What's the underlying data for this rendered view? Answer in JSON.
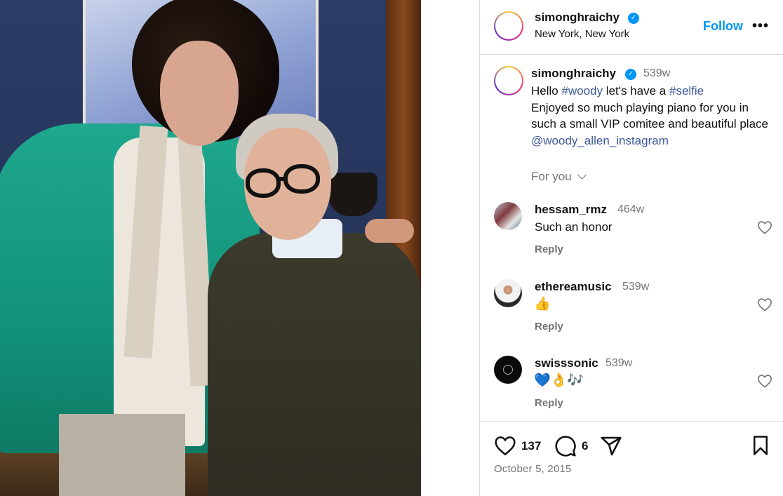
{
  "post": {
    "author": "simonghraichy",
    "location": "New York, New York",
    "follow_label": "Follow",
    "more_label": "•••"
  },
  "caption": {
    "author": "simonghraichy",
    "age": "539w",
    "line1_prefix": "Hello ",
    "hashtag1": "#woody",
    "line1_mid": " let's have a ",
    "hashtag2": "#selfie",
    "body": "Enjoyed so much playing piano for you in such a small VIP comitee and beautiful place ",
    "mention": "@woody_allen_instagram"
  },
  "for_you_label": "For you",
  "comments": [
    {
      "user": "hessam_rmz",
      "age": "464w",
      "text": "Such an honor",
      "reply_label": "Reply"
    },
    {
      "user": "ethereamusic",
      "age": "539w",
      "text": "👍",
      "reply_label": "Reply"
    },
    {
      "user": "swisssonic",
      "age": "539w",
      "text": "💙👌🎶",
      "reply_label": "Reply"
    }
  ],
  "actions": {
    "likes": "137",
    "comments": "6"
  },
  "date": "October 5, 2015",
  "colors": {
    "accent": "#0095f6",
    "link": "#3d5a98",
    "muted": "#737373",
    "border": "#dbdbdb"
  }
}
